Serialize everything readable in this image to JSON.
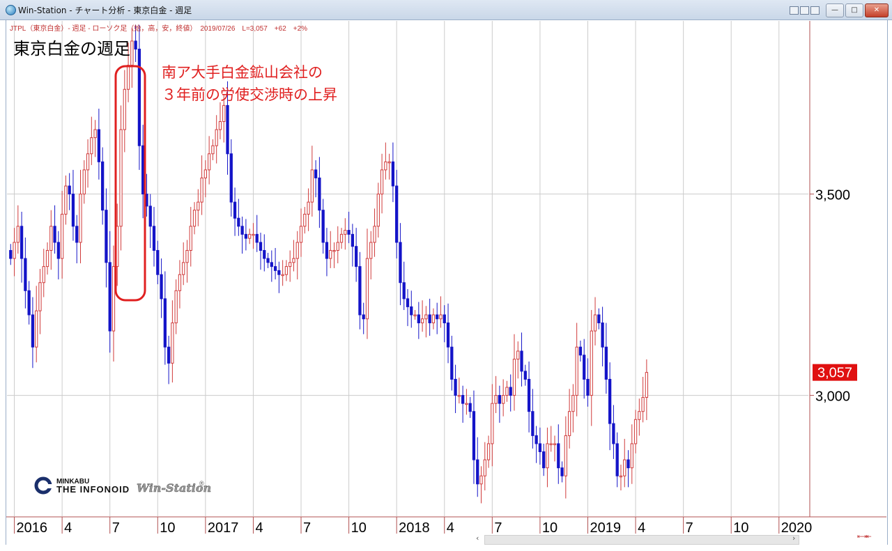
{
  "window": {
    "title": "Win-Station - チャート分析 - 東京白金 - 週足",
    "controls": [
      "□",
      "—",
      "✕"
    ]
  },
  "chart_header": {
    "info": "JTPL（東京白金）- 週足 - ローソク足（始，高，安，終値）　2019/07/26　L=3,057　+62　+2%",
    "title": "東京白金の週足"
  },
  "annotation": {
    "line1": "南ア大手白金鉱山会社の",
    "line2": "３年前の労使交渉時の上昇"
  },
  "logo": {
    "brand_small": "MINKABU",
    "brand_big": "THE INFONOID",
    "product": "Win-Station",
    "registered": "®"
  },
  "colors": {
    "up": "#d03a3a",
    "down": "#1414c8",
    "wick_up": "#d03a3a",
    "wick_down": "#1414c8",
    "grid": "#cccccc",
    "last_price_bg": "#e01010",
    "axis_line": "#b05050",
    "annotation": "#e02020"
  },
  "chart_data": {
    "type": "candlestick",
    "symbol": "JTPL",
    "period": "weekly",
    "last_date": "2019/07/26",
    "last_price": 3057,
    "last_price_label": "3,057",
    "change": "+62",
    "change_pct": "+2%",
    "y_ticks": [
      {
        "value": 3500,
        "label": "3,500"
      },
      {
        "value": 3000,
        "label": "3,000"
      }
    ],
    "x_ticks": [
      {
        "week": 2,
        "label": "2016",
        "major": true
      },
      {
        "week": 15,
        "label": "4",
        "major": false
      },
      {
        "week": 28,
        "label": "7",
        "major": false
      },
      {
        "week": 41,
        "label": "10",
        "major": false
      },
      {
        "week": 54,
        "label": "2017",
        "major": true
      },
      {
        "week": 67,
        "label": "4",
        "major": false
      },
      {
        "week": 80,
        "label": "7",
        "major": false
      },
      {
        "week": 93,
        "label": "10",
        "major": false
      },
      {
        "week": 106,
        "label": "2018",
        "major": true
      },
      {
        "week": 119,
        "label": "4",
        "major": false
      },
      {
        "week": 132,
        "label": "7",
        "major": false
      },
      {
        "week": 145,
        "label": "10",
        "major": false
      },
      {
        "week": 158,
        "label": "2019",
        "major": true
      },
      {
        "week": 171,
        "label": "4",
        "major": false
      },
      {
        "week": 184,
        "label": "7",
        "major": false
      },
      {
        "week": 197,
        "label": "10",
        "major": false
      },
      {
        "week": 210,
        "label": "2020",
        "major": true
      }
    ],
    "closes": [
      3340,
      3380,
      3420,
      3340,
      3260,
      3200,
      3120,
      3210,
      3280,
      3320,
      3360,
      3420,
      3380,
      3340,
      3450,
      3520,
      3500,
      3420,
      3380,
      3500,
      3560,
      3600,
      3640,
      3660,
      3580,
      3460,
      3330,
      3160,
      3320,
      3420,
      3660,
      3760,
      3820,
      3880,
      3860,
      3620,
      3500,
      3470,
      3420,
      3360,
      3300,
      3240,
      3120,
      3080,
      3180,
      3260,
      3300,
      3330,
      3360,
      3420,
      3460,
      3480,
      3540,
      3560,
      3600,
      3620,
      3660,
      3680,
      3720,
      3600,
      3480,
      3440,
      3420,
      3400,
      3390,
      3400,
      3400,
      3380,
      3360,
      3340,
      3330,
      3320,
      3310,
      3300,
      3300,
      3320,
      3330,
      3340,
      3380,
      3420,
      3450,
      3480,
      3560,
      3540,
      3460,
      3380,
      3340,
      3360,
      3360,
      3380,
      3400,
      3410,
      3400,
      3370,
      3320,
      3200,
      3190,
      3340,
      3380,
      3420,
      3500,
      3560,
      3580,
      3580,
      3520,
      3380,
      3280,
      3240,
      3220,
      3200,
      3200,
      3180,
      3190,
      3200,
      3180,
      3200,
      3190,
      3200,
      3180,
      3120,
      3040,
      3000,
      3000,
      2980,
      2980,
      2960,
      2840,
      2780,
      2800,
      2840,
      2880,
      2980,
      3000,
      2980,
      3000,
      3020,
      3000,
      3090,
      3110,
      3060,
      3040,
      2960,
      2900,
      2880,
      2860,
      2820,
      2880,
      2880,
      2880,
      2820,
      2800,
      2900,
      2960,
      3000,
      3120,
      3100,
      3040,
      3000,
      3160,
      3200,
      3180,
      3120,
      3040,
      2930,
      2880,
      2800,
      2800,
      2840,
      2820,
      2880,
      2940,
      2960,
      2995,
      3057
    ],
    "x_range_weeks": [
      0,
      218
    ],
    "ylim": [
      2700,
      3930
    ]
  }
}
